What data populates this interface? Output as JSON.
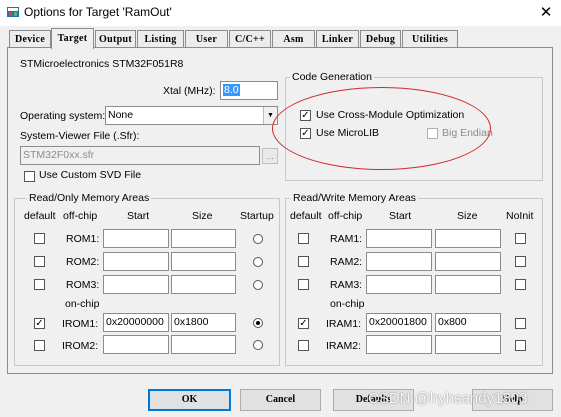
{
  "window": {
    "title": "Options for Target 'RamOut'"
  },
  "tabs": [
    {
      "label": "Device"
    },
    {
      "label": "Target"
    },
    {
      "label": "Output"
    },
    {
      "label": "Listing"
    },
    {
      "label": "User"
    },
    {
      "label": "C/C++"
    },
    {
      "label": "Asm"
    },
    {
      "label": "Linker"
    },
    {
      "label": "Debug"
    },
    {
      "label": "Utilities"
    }
  ],
  "active_tab": "Target",
  "device": {
    "name": "STMicroelectronics STM32F051R8"
  },
  "xtal": {
    "label": "Xtal (MHz):",
    "value": "8.0"
  },
  "os": {
    "label": "Operating system:",
    "value": "None"
  },
  "sfr": {
    "label": "System-Viewer File (.Sfr):",
    "value": "STM32F0xx.sfr",
    "browse": "..."
  },
  "custom_svd": {
    "label": "Use Custom SVD File",
    "checked": false
  },
  "codegen": {
    "title": "Code Generation",
    "cross_module": {
      "label": "Use Cross-Module Optimization",
      "checked": true
    },
    "microlib": {
      "label": "Use MicroLIB",
      "checked": true
    },
    "big_endian": {
      "label": "Big Endian",
      "checked": false
    }
  },
  "ro_memory": {
    "title": "Read/Only Memory Areas",
    "headers": {
      "default": "default",
      "offchip": "off-chip",
      "start": "Start",
      "size": "Size",
      "startup": "Startup",
      "onchip": "on-chip"
    },
    "rows": [
      {
        "label": "ROM1:",
        "default": false,
        "start": "",
        "size": "",
        "startup": false
      },
      {
        "label": "ROM2:",
        "default": false,
        "start": "",
        "size": "",
        "startup": false
      },
      {
        "label": "ROM3:",
        "default": false,
        "start": "",
        "size": "",
        "startup": false
      },
      {
        "label": "IROM1:",
        "default": true,
        "start": "0x20000000",
        "size": "0x1800",
        "startup": true
      },
      {
        "label": "IROM2:",
        "default": false,
        "start": "",
        "size": "",
        "startup": false
      }
    ]
  },
  "rw_memory": {
    "title": "Read/Write Memory Areas",
    "headers": {
      "default": "default",
      "offchip": "off-chip",
      "start": "Start",
      "size": "Size",
      "noinit": "NoInit",
      "onchip": "on-chip"
    },
    "rows": [
      {
        "label": "RAM1:",
        "default": false,
        "start": "",
        "size": "",
        "noinit": false
      },
      {
        "label": "RAM2:",
        "default": false,
        "start": "",
        "size": "",
        "noinit": false
      },
      {
        "label": "RAM3:",
        "default": false,
        "start": "",
        "size": "",
        "noinit": false
      },
      {
        "label": "IRAM1:",
        "default": true,
        "start": "0x20001800",
        "size": "0x800",
        "noinit": false
      },
      {
        "label": "IRAM2:",
        "default": false,
        "start": "",
        "size": "",
        "noinit": false
      }
    ]
  },
  "buttons": {
    "ok": "OK",
    "cancel": "Cancel",
    "defaults": "Defaults",
    "help": "Help"
  },
  "watermark": "CSDN @hyhsandy1803",
  "colors": {
    "annotation": "#d42a2a",
    "focus": "#0078d7",
    "selection": "#3399ff"
  }
}
